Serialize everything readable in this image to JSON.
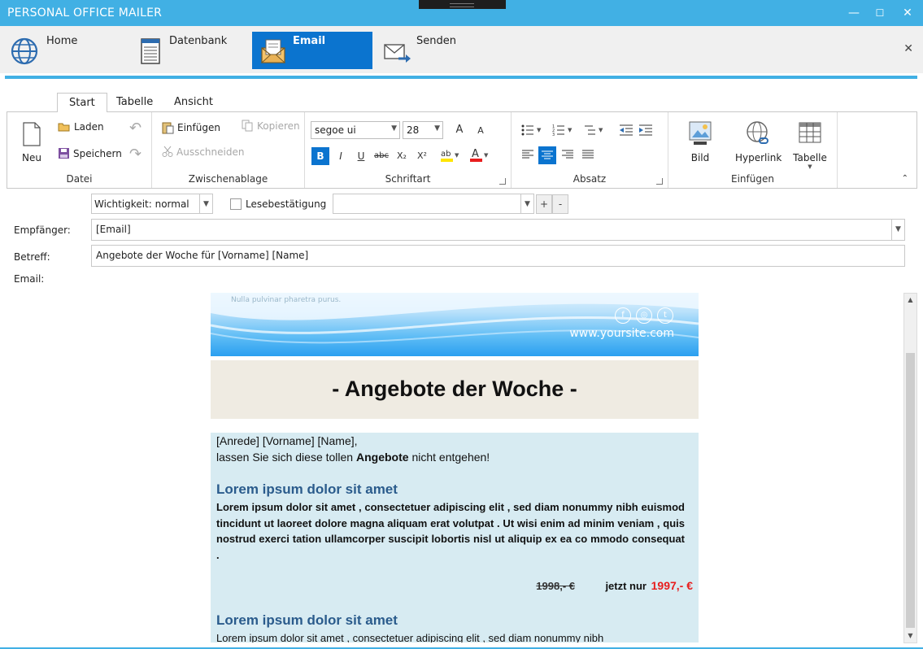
{
  "window": {
    "title": "PERSONAL OFFICE MAILER",
    "minimize": "—",
    "maximize": "☐",
    "close": "✕"
  },
  "nav": {
    "items": [
      {
        "label": "Home",
        "icon": "globe-icon"
      },
      {
        "label": "Datenbank",
        "icon": "database-icon"
      },
      {
        "label": "Email",
        "icon": "email-icon",
        "active": true
      },
      {
        "label": "Senden",
        "icon": "send-icon"
      }
    ],
    "close": "✕"
  },
  "ribbon": {
    "tabs": [
      "Start",
      "Tabelle",
      "Ansicht"
    ],
    "active_tab": "Start",
    "groups": {
      "datei": {
        "label": "Datei",
        "neu": "Neu",
        "laden": "Laden",
        "speichern": "Speichern",
        "undo": "↶",
        "redo": "↷"
      },
      "clipboard": {
        "label": "Zwischenablage",
        "einfuegen": "Einfügen",
        "kopieren": "Kopieren",
        "ausschneiden": "Ausschneiden"
      },
      "schriftart": {
        "label": "Schriftart",
        "font": "segoe ui",
        "size": "28",
        "grow": "A",
        "shrink": "A",
        "bold": "B",
        "italic": "I",
        "underline": "U",
        "strike": "abc",
        "sub": "X₂",
        "sup": "X²"
      },
      "absatz": {
        "label": "Absatz"
      },
      "einfuegen": {
        "label": "Einfügen",
        "bild": "Bild",
        "hyperlink": "Hyperlink",
        "tabelle": "Tabelle"
      }
    },
    "collapse": "⌃"
  },
  "form": {
    "importance": "Wichtigkeit: normal",
    "read_receipt": "Lesebestätigung",
    "plus": "+",
    "minus": "-",
    "recipient_label": "Empfänger:",
    "recipient_value": "[Email]",
    "subject_label": "Betreff:",
    "subject_value": "Angebote der Woche für [Vorname] [Name]",
    "email_label": "Email:"
  },
  "email": {
    "banner_faded": "Nulla pulvinar pharetra purus.",
    "site": "www.yoursite.com",
    "social": [
      "f",
      "◎",
      "t"
    ],
    "headline": "- Angebote der Woche -",
    "greeting": "[Anrede] [Vorname] [Name],",
    "intro_pre": "lassen Sie sich diese tollen ",
    "intro_bold": "Angebote",
    "intro_post": " nicht entgehen!",
    "heading1": "Lorem ipsum dolor sit amet",
    "para1": "Lorem ipsum dolor sit amet , consectetuer adipiscing elit , sed diam nonummy nibh euismod tincidunt ut laoreet dolore magna aliquam erat volutpat . Ut wisi enim ad minim veniam , quis nostrud exerci tation ullamcorper suscipit lobortis nisl ut aliquip ex ea co mmodo consequat .",
    "price_old": "1998,- €",
    "price_label": "jetzt nur",
    "price_new": "1997,- €",
    "heading2": "Lorem ipsum dolor sit amet",
    "para2": "Lorem ipsum dolor sit amet , consectetuer adipiscing elit , sed diam nonummy nibh"
  },
  "colors": {
    "accent": "#41b0e4",
    "active_nav": "#0b74cf",
    "heading": "#2a5b8c",
    "price": "#e81d1d"
  }
}
